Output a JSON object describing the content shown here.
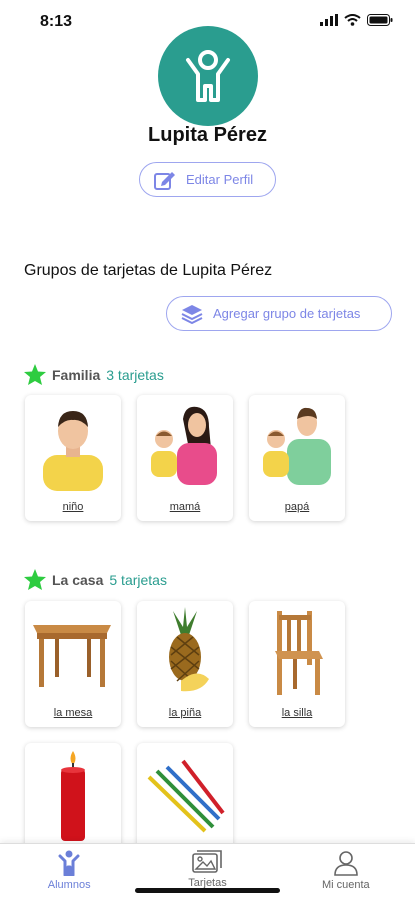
{
  "status": {
    "time": "8:13"
  },
  "profile": {
    "name": "Lupita Pérez",
    "edit_label": "Editar Perfil"
  },
  "groups_heading": "Grupos de tarjetas de Lupita Pérez",
  "add_group_label": "Agregar grupo de tarjetas",
  "groups": [
    {
      "title": "Familia",
      "count": "3 tarjetas",
      "cards": [
        {
          "label": "niño",
          "icon": "boy-photo"
        },
        {
          "label": "mamá",
          "icon": "mother-photo"
        },
        {
          "label": "papá",
          "icon": "father-photo"
        }
      ]
    },
    {
      "title": "La casa",
      "count": "5 tarjetas",
      "cards": [
        {
          "label": "la mesa",
          "icon": "table-photo"
        },
        {
          "label": "la piña",
          "icon": "pineapple-photo"
        },
        {
          "label": "la silla",
          "icon": "chair-photo"
        },
        {
          "label": "",
          "icon": "candle-photo"
        },
        {
          "label": "",
          "icon": "pencils-photo"
        }
      ]
    }
  ],
  "tabs": [
    {
      "label": "Alumnos",
      "icon": "student-icon",
      "active": true
    },
    {
      "label": "Tarjetas",
      "icon": "cards-icon",
      "active": false
    },
    {
      "label": "Mi cuenta",
      "icon": "account-icon",
      "active": false
    }
  ],
  "colors": {
    "accent_teal": "#2a9d8f",
    "button_outline": "#9ea6ef",
    "active_tab": "#6b7fd8",
    "star": "#2ecc40"
  }
}
